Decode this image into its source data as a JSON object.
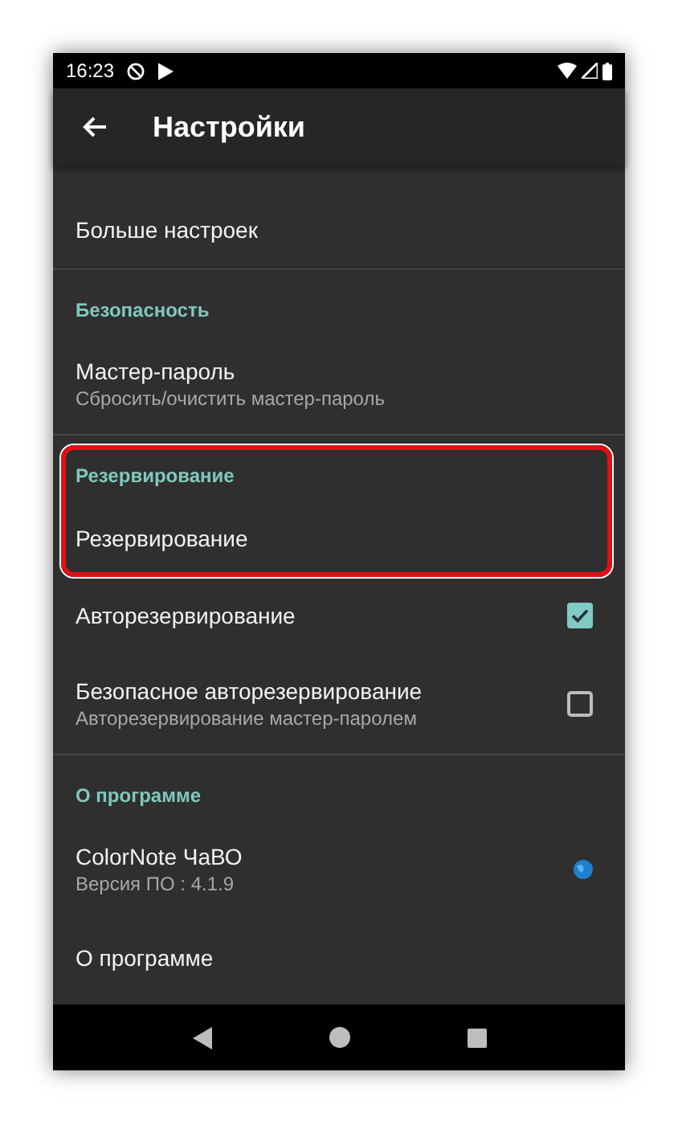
{
  "status_bar": {
    "time": "16:23"
  },
  "toolbar": {
    "title": "Настройки"
  },
  "sections": [
    {
      "items": [
        {
          "kind": "plain",
          "title": "Больше настроек"
        }
      ]
    },
    {
      "header": "Безопасность",
      "highlighted": false,
      "items": [
        {
          "kind": "plain",
          "title": "Мастер-пароль",
          "summary": "Сбросить/очистить мастер-пароль"
        }
      ]
    },
    {
      "header": "Резервирование",
      "highlighted": true,
      "items": [
        {
          "kind": "plain",
          "title": "Резервирование"
        },
        {
          "kind": "checkbox",
          "title": "Авторезервирование",
          "checked": true
        },
        {
          "kind": "checkbox",
          "title": "Безопасное авторезервирование",
          "summary": "Авторезервирование мастер-паролем",
          "checked": false
        }
      ]
    },
    {
      "header": "О программе",
      "highlighted": false,
      "items": [
        {
          "kind": "link",
          "title": "ColorNote ЧаВО",
          "summary": "Версия ПО : 4.1.9"
        },
        {
          "kind": "plain",
          "title": "О программе"
        }
      ]
    }
  ]
}
